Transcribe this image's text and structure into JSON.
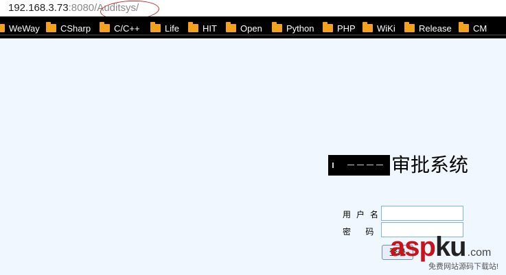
{
  "address_bar": {
    "host": "192.168.3.73",
    "port": ":8080",
    "path": "/Auditsys/"
  },
  "bookmarks": [
    {
      "label": "WeWay"
    },
    {
      "label": "CSharp"
    },
    {
      "label": "C/C++"
    },
    {
      "label": "Life"
    },
    {
      "label": "HIT"
    },
    {
      "label": "Open"
    },
    {
      "label": "Python"
    },
    {
      "label": "PHP"
    },
    {
      "label": "WiKi"
    },
    {
      "label": "Release"
    },
    {
      "label": "CM"
    }
  ],
  "page": {
    "title": "审批系统",
    "username_label": "用户名",
    "password_label": "密 码",
    "username_value": "",
    "password_value": "",
    "login_label": "登录"
  },
  "watermark": {
    "asp": "asp",
    "ku": "ku",
    "dotcom": ".com",
    "subtitle": "免费网站源码下载站!"
  },
  "colors": {
    "page_bg": "#f1f7fe",
    "bookmark_bar_bg": "#000000",
    "folder_icon": "#f4a21c",
    "annotation_ellipse": "#c8262b",
    "watermark_red": "#c8131b"
  }
}
